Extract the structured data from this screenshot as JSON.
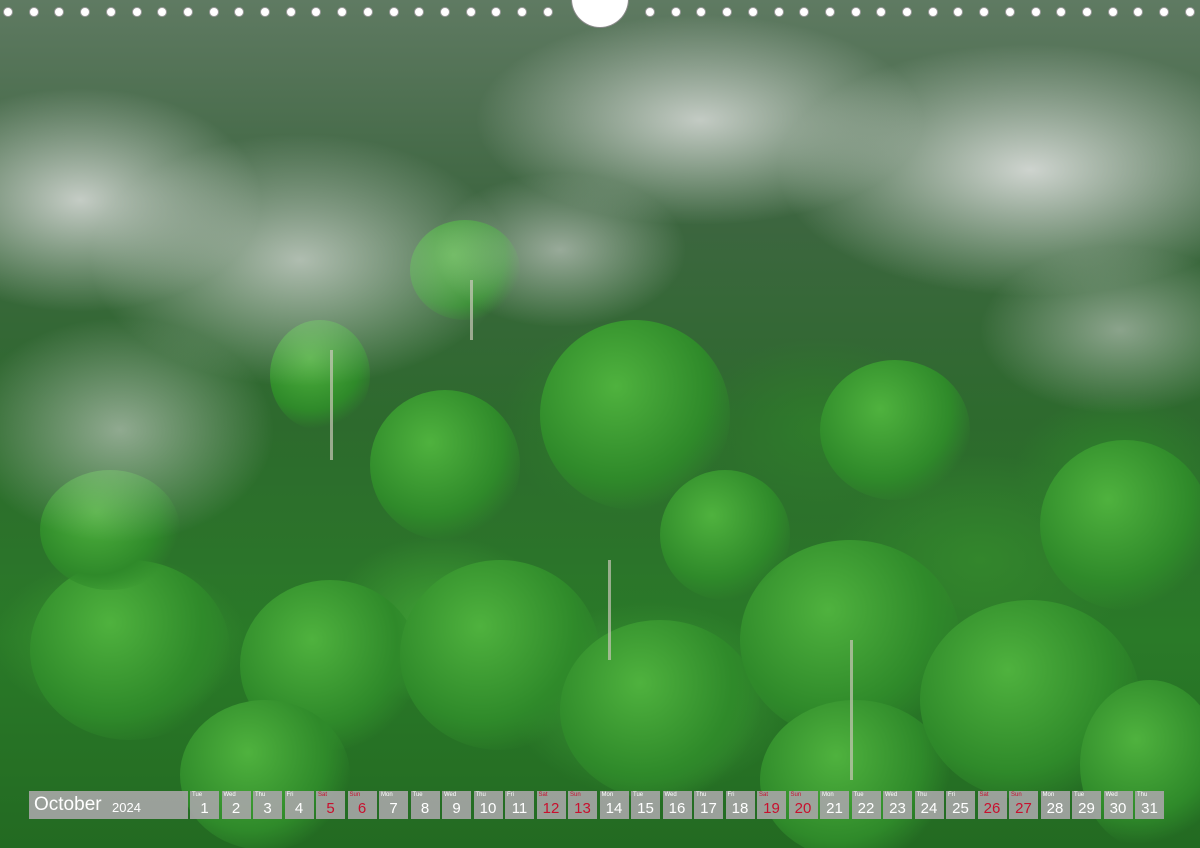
{
  "calendar": {
    "month": "October",
    "year": "2024",
    "weekend_color": "#c8102e",
    "days": [
      {
        "dow": "Tue",
        "num": "1",
        "weekend": false
      },
      {
        "dow": "Wed",
        "num": "2",
        "weekend": false
      },
      {
        "dow": "Thu",
        "num": "3",
        "weekend": false
      },
      {
        "dow": "Fri",
        "num": "4",
        "weekend": false
      },
      {
        "dow": "Sat",
        "num": "5",
        "weekend": true
      },
      {
        "dow": "Sun",
        "num": "6",
        "weekend": true
      },
      {
        "dow": "Mon",
        "num": "7",
        "weekend": false
      },
      {
        "dow": "Tue",
        "num": "8",
        "weekend": false
      },
      {
        "dow": "Wed",
        "num": "9",
        "weekend": false
      },
      {
        "dow": "Thu",
        "num": "10",
        "weekend": false
      },
      {
        "dow": "Fri",
        "num": "11",
        "weekend": false
      },
      {
        "dow": "Sat",
        "num": "12",
        "weekend": true
      },
      {
        "dow": "Sun",
        "num": "13",
        "weekend": true
      },
      {
        "dow": "Mon",
        "num": "14",
        "weekend": false
      },
      {
        "dow": "Tue",
        "num": "15",
        "weekend": false
      },
      {
        "dow": "Wed",
        "num": "16",
        "weekend": false
      },
      {
        "dow": "Thu",
        "num": "17",
        "weekend": false
      },
      {
        "dow": "Fri",
        "num": "18",
        "weekend": false
      },
      {
        "dow": "Sat",
        "num": "19",
        "weekend": true
      },
      {
        "dow": "Sun",
        "num": "20",
        "weekend": true
      },
      {
        "dow": "Mon",
        "num": "21",
        "weekend": false
      },
      {
        "dow": "Tue",
        "num": "22",
        "weekend": false
      },
      {
        "dow": "Wed",
        "num": "23",
        "weekend": false
      },
      {
        "dow": "Thu",
        "num": "24",
        "weekend": false
      },
      {
        "dow": "Fri",
        "num": "25",
        "weekend": false
      },
      {
        "dow": "Sat",
        "num": "26",
        "weekend": true
      },
      {
        "dow": "Sun",
        "num": "27",
        "weekend": true
      },
      {
        "dow": "Mon",
        "num": "28",
        "weekend": false
      },
      {
        "dow": "Tue",
        "num": "29",
        "weekend": false
      },
      {
        "dow": "Wed",
        "num": "30",
        "weekend": false
      },
      {
        "dow": "Thu",
        "num": "31",
        "weekend": false
      }
    ]
  }
}
